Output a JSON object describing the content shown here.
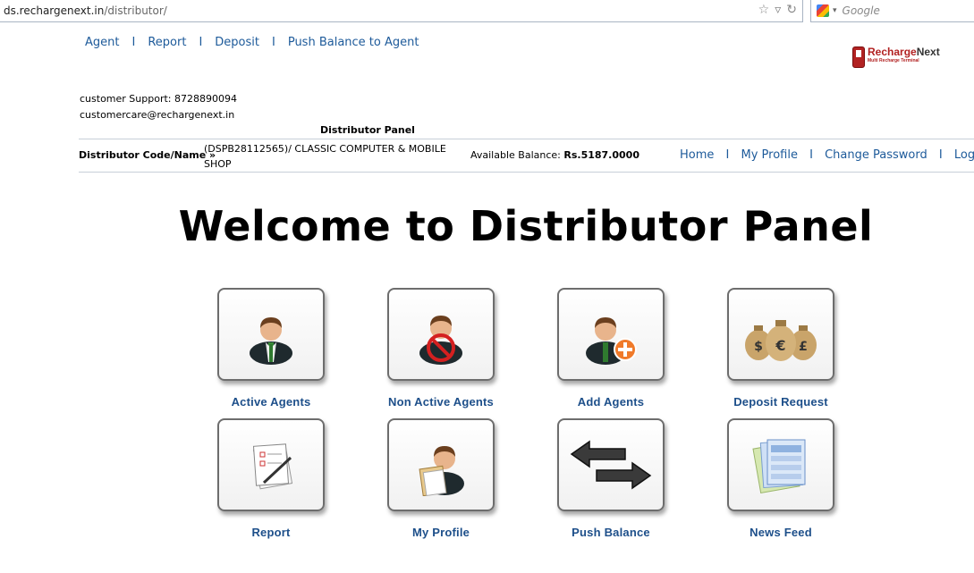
{
  "browser": {
    "url_host": "ds.rechargenext.in",
    "url_path": "/distributor/",
    "search_placeholder": "Google"
  },
  "topnav": [
    "Agent",
    "Report",
    "Deposit",
    "Push Balance to Agent"
  ],
  "logo": {
    "brand_a": "Recharge",
    "brand_b": "Next",
    "tagline": "Multi Recharge Terminal"
  },
  "support": {
    "phone_line": "customer Support: 8728890094",
    "email": "customercare@rechargenext.in"
  },
  "panel_title": "Distributor Panel",
  "distributor": {
    "code_label": "Distributor Code/Name »",
    "code_value": "(DSPB28112565)/ CLASSIC COMPUTER & MOBILE SHOP",
    "balance_label": "Available Balance:",
    "balance_value": "Rs.5187.0000"
  },
  "header_links": [
    "Home",
    "My Profile",
    "Change Password",
    "Logout"
  ],
  "welcome": "Welcome to Distributor Panel",
  "tiles": [
    {
      "label": "Active Agents",
      "icon": "agent-icon"
    },
    {
      "label": "Non Active Agents",
      "icon": "agent-blocked-icon"
    },
    {
      "label": "Add Agents",
      "icon": "agent-add-icon"
    },
    {
      "label": "Deposit Request",
      "icon": "money-bags-icon"
    },
    {
      "label": "Report",
      "icon": "report-icon"
    },
    {
      "label": "My Profile",
      "icon": "profile-icon"
    },
    {
      "label": "Push Balance",
      "icon": "transfer-arrows-icon"
    },
    {
      "label": "News Feed",
      "icon": "news-feed-icon"
    }
  ],
  "colors": {
    "link": "#1d5a9a",
    "tile_label": "#1d4f8a",
    "brand_red": "#b22222"
  }
}
